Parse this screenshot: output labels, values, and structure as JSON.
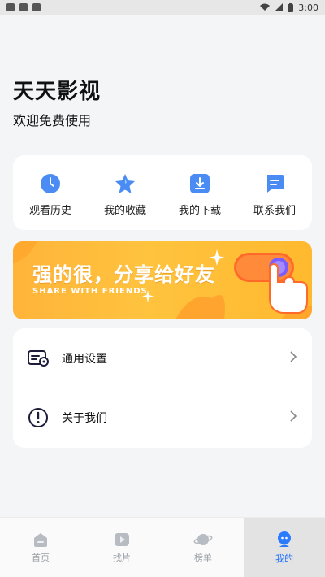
{
  "status_bar": {
    "time": "3:00"
  },
  "header": {
    "title": "天天影视",
    "subtitle": "欢迎免费使用"
  },
  "quick_actions": [
    {
      "label": "观看历史",
      "icon": "clock-icon"
    },
    {
      "label": "我的收藏",
      "icon": "star-icon"
    },
    {
      "label": "我的下载",
      "icon": "download-icon"
    },
    {
      "label": "联系我们",
      "icon": "message-icon"
    }
  ],
  "banner": {
    "title": "强的很，分享给好友",
    "subtitle": "SHARE WITH FRIENDS"
  },
  "settings": [
    {
      "label": "通用设置",
      "icon": "settings-icon"
    },
    {
      "label": "关于我们",
      "icon": "info-icon"
    }
  ],
  "tabs": [
    {
      "label": "首页",
      "icon": "home-icon"
    },
    {
      "label": "找片",
      "icon": "play-icon"
    },
    {
      "label": "榜单",
      "icon": "planet-icon"
    },
    {
      "label": "我的",
      "icon": "user-icon",
      "active": true
    }
  ],
  "colors": {
    "accent": "#1f6fff",
    "banner": "#ffbd39",
    "background": "#f4f5f7"
  }
}
